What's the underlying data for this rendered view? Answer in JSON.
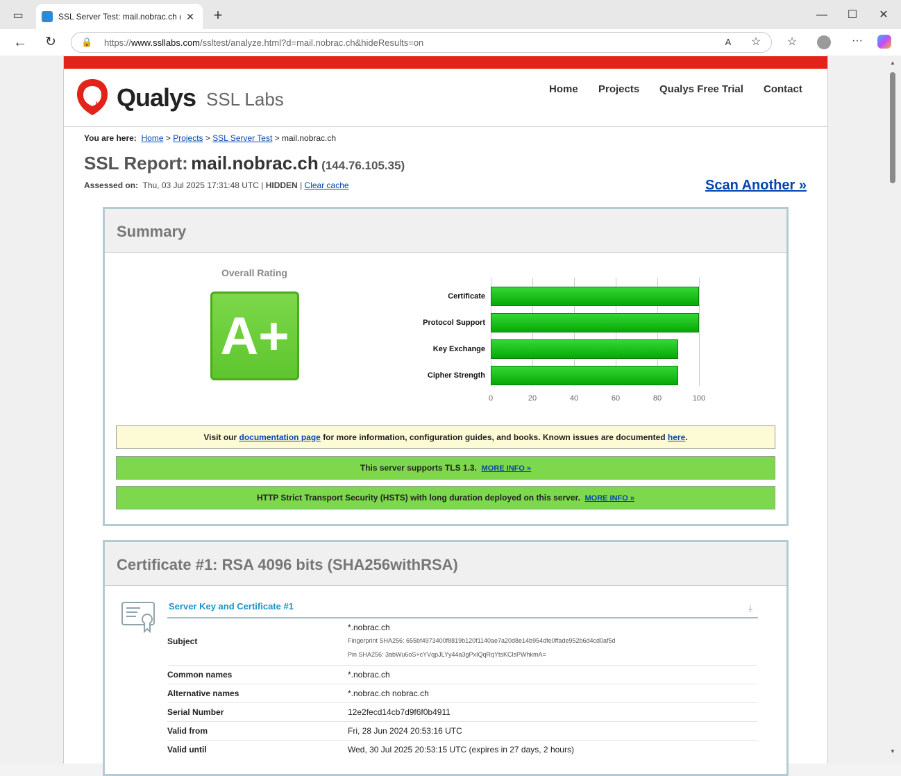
{
  "browser": {
    "tab_title": "SSL Server Test: mail.nobrac.ch (P...",
    "url_prefix": "https://",
    "url_host": "www.ssllabs.com",
    "url_path": "/ssltest/analyze.html?d=mail.nobrac.ch&hideResults=on"
  },
  "site": {
    "logo_brand": "Qualys",
    "logo_product": "SSL Labs",
    "nav": [
      "Home",
      "Projects",
      "Qualys Free Trial",
      "Contact"
    ]
  },
  "breadcrumb": {
    "prefix": "You are here:",
    "items": [
      "Home",
      "Projects",
      "SSL Server Test"
    ],
    "current": "mail.nobrac.ch",
    "sep": ">"
  },
  "report": {
    "title_label": "SSL Report:",
    "host": "mail.nobrac.ch",
    "ip": "(144.76.105.35)",
    "assessed_label": "Assessed on:",
    "assessed_value": "Thu, 03 Jul 2025 17:31:48 UTC",
    "hidden_label": "HIDDEN",
    "clear_cache": "Clear cache",
    "scan_another": "Scan Another »"
  },
  "summary": {
    "title": "Summary",
    "overall_label": "Overall Rating",
    "grade": "A+",
    "grade_color": "#69cc3a",
    "notice_doc_pre": "Visit our",
    "notice_doc_link": "documentation page",
    "notice_doc_mid": "for more information, configuration guides, and books. Known issues are documented",
    "notice_doc_link2": "here",
    "notice_doc_end": ".",
    "notice_tls_text": "This server supports TLS 1.3.",
    "notice_hsts_text": "HTTP Strict Transport Security (HSTS) with long duration deployed on this server.",
    "more_info": "MORE INFO »"
  },
  "chart_data": {
    "type": "bar",
    "orientation": "horizontal",
    "categories": [
      "Certificate",
      "Protocol Support",
      "Key Exchange",
      "Cipher Strength"
    ],
    "values": [
      100,
      100,
      90,
      90
    ],
    "xlim": [
      0,
      100
    ],
    "ticks": [
      0,
      20,
      40,
      60,
      80,
      100
    ],
    "bar_color": "#1cc01c"
  },
  "certificate": {
    "title": "Certificate #1: RSA 4096 bits (SHA256withRSA)",
    "section_title": "Server Key and Certificate #1",
    "rows": [
      {
        "label": "Subject",
        "value": "*.nobrac.ch"
      },
      {
        "label": "Common names",
        "value": "*.nobrac.ch"
      },
      {
        "label": "Alternative names",
        "value": "*.nobrac.ch nobrac.ch"
      },
      {
        "label": "Serial Number",
        "value": "12e2fecd14cb7d9f6f0b4911"
      },
      {
        "label": "Valid from",
        "value": "Fri, 28 Jun 2024 20:53:16 UTC"
      },
      {
        "label": "Valid until",
        "value": "Wed, 30 Jul 2025 20:53:15 UTC (expires in 27 days, 2 hours)"
      }
    ],
    "fingerprint": "Fingerprint SHA256: 655bf4973400f8819b120f1140ae7a20d8e14b954dfe0ffade952b6d4cd0af5d",
    "pin": "Pin SHA256: 3abWu6oS+cYVqpJLYy44a3gPxIQqRqYtsKClsPWhkmA="
  }
}
